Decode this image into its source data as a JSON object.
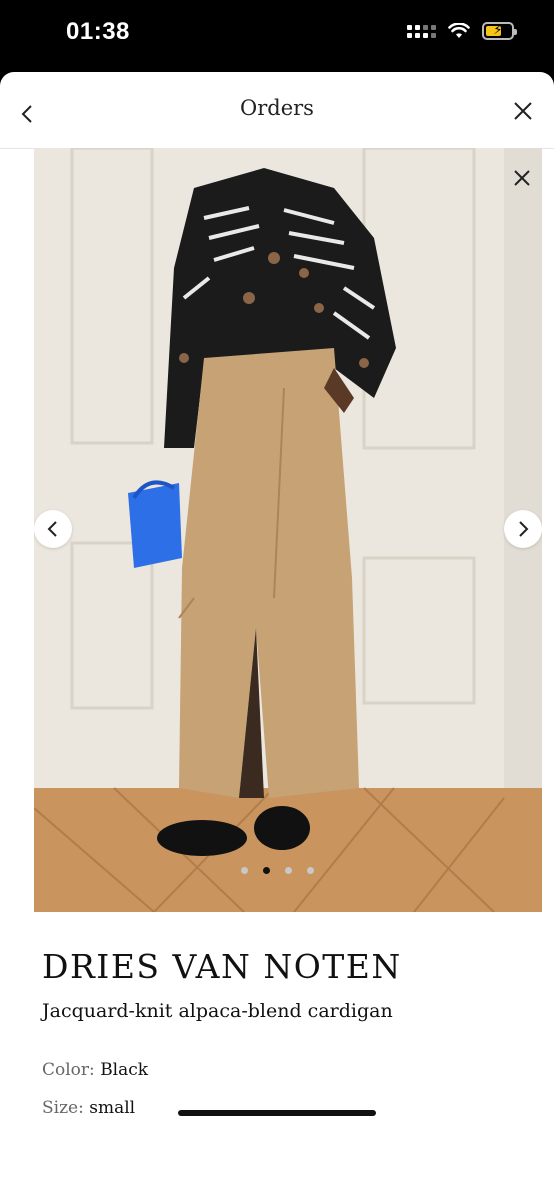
{
  "status_bar": {
    "time": "01:38"
  },
  "nav": {
    "title": "Orders"
  },
  "gallery": {
    "image_count": 4,
    "active_index": 1
  },
  "product": {
    "brand": "DRIES VAN NOTEN",
    "name": "Jacquard-knit alpaca-blend cardigan",
    "color_label": "Color:",
    "color_value": "Black",
    "size_label": "Size:",
    "size_value": "small"
  },
  "icons": {
    "back": "chevron-left-icon",
    "close": "close-icon",
    "prev": "chevron-left-icon",
    "next": "chevron-right-icon"
  }
}
